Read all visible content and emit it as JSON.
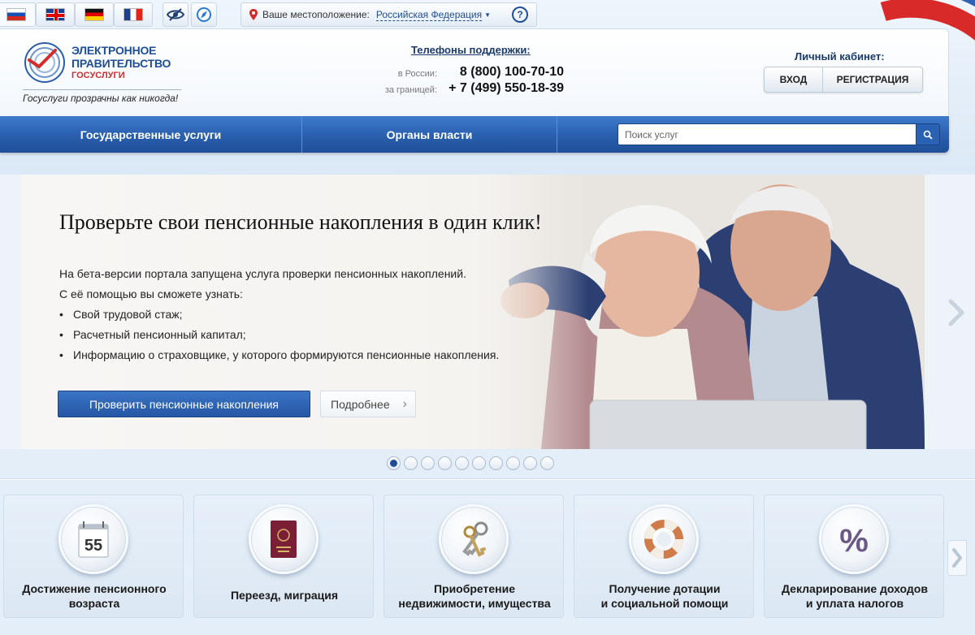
{
  "languages": [
    {
      "code": "ru",
      "label": "Русский",
      "active": true
    },
    {
      "code": "en",
      "label": "English",
      "active": false
    },
    {
      "code": "de",
      "label": "Deutsch",
      "active": false
    },
    {
      "code": "fr",
      "label": "Français",
      "active": false
    }
  ],
  "tools": [
    "low-vision-icon",
    "compass-icon"
  ],
  "location": {
    "label": "Ваше местоположение:",
    "region": "Российская Федерация",
    "help": "?"
  },
  "logo": {
    "line1": "ЭЛЕКТРОННОЕ",
    "line2": "ПРАВИТЕЛЬСТВО",
    "line3": "ГОСУСЛУГИ",
    "slogan": "Госуслуги прозрачны как никогда!"
  },
  "support": {
    "title": "Телефоны поддержки:",
    "russia_label": "в России:",
    "russia_number": "8 (800) 100-70-10",
    "abroad_label": "за границей:",
    "abroad_number": "+ 7 (499) 550-18-39"
  },
  "cabinet": {
    "title": "Личный кабинет:",
    "login_label": "ВХОД",
    "register_label": "РЕГИСТРАЦИЯ"
  },
  "nav": {
    "item1": "Государственные услуги",
    "item2": "Органы власти",
    "search_placeholder": "Поиск услуг"
  },
  "banner": {
    "title": "Проверьте свои пенсионные накопления в один клик!",
    "intro1": "На бета-версии портала запущена услуга проверки пенсионных накоплений.",
    "intro2": "С её помощью вы сможете узнать:",
    "bullets": [
      "Свой трудовой стаж;",
      "Расчетный пенсионный капитал;",
      "Информацию о страховщике, у которого формируются пенсионные накопления."
    ],
    "primary_button": "Проверить пенсионные накопления",
    "secondary_button": "Подробнее"
  },
  "carousel": {
    "total": 10,
    "active_index": 0
  },
  "cards": [
    {
      "line1": "Достижение пенсионного",
      "line2": "возраста",
      "icon": "calendar-55-icon",
      "icon_text": "55"
    },
    {
      "line1": "Переезд, миграция",
      "line2": "",
      "icon": "passport-icon"
    },
    {
      "line1": "Приобретение",
      "line2": "недвижимости, имущества",
      "icon": "keys-icon"
    },
    {
      "line1": "Получение дотации",
      "line2": "и социальной помощи",
      "icon": "lifebuoy-icon"
    },
    {
      "line1": "Декларирование доходов",
      "line2": "и уплата налогов",
      "icon": "percent-icon",
      "icon_text": "%"
    }
  ],
  "colors": {
    "brand_blue": "#1f4e96",
    "nav_blue": "#2a61b0",
    "brand_red": "#d42a2a"
  }
}
